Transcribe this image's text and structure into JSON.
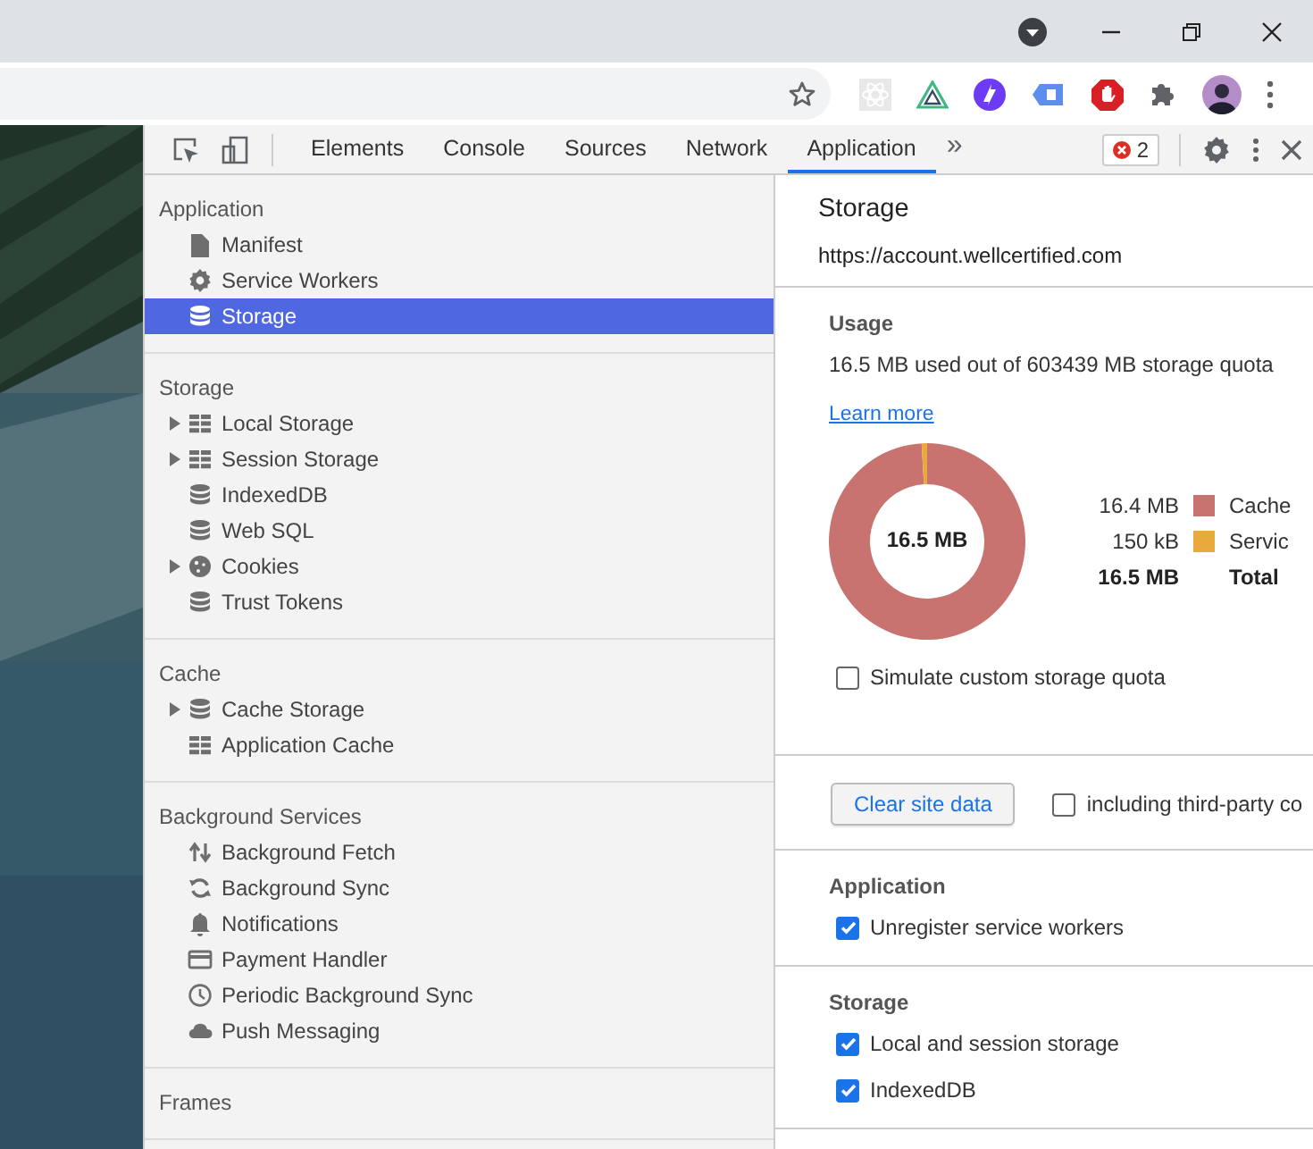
{
  "devtools": {
    "tabs": [
      {
        "label": "Elements",
        "selected": false
      },
      {
        "label": "Console",
        "selected": false
      },
      {
        "label": "Sources",
        "selected": false
      },
      {
        "label": "Network",
        "selected": false
      },
      {
        "label": "Application",
        "selected": true
      }
    ],
    "more_tabs": "»",
    "error_count": "2"
  },
  "sidebar": {
    "sections": [
      {
        "title": "Application",
        "items": [
          {
            "label": "Manifest",
            "kind": "manifest",
            "expandable": false,
            "selected": false
          },
          {
            "label": "Service Workers",
            "kind": "gear",
            "expandable": false,
            "selected": false
          },
          {
            "label": "Storage",
            "kind": "database",
            "expandable": false,
            "selected": true
          }
        ]
      },
      {
        "title": "Storage",
        "items": [
          {
            "label": "Local Storage",
            "kind": "table",
            "expandable": true,
            "expanded": false,
            "selected": false
          },
          {
            "label": "Session Storage",
            "kind": "table",
            "expandable": true,
            "expanded": false,
            "selected": false
          },
          {
            "label": "IndexedDB",
            "kind": "database",
            "expandable": false,
            "selected": false
          },
          {
            "label": "Web SQL",
            "kind": "database",
            "expandable": false,
            "selected": false
          },
          {
            "label": "Cookies",
            "kind": "cookie",
            "expandable": true,
            "expanded": false,
            "selected": false
          },
          {
            "label": "Trust Tokens",
            "kind": "database",
            "expandable": false,
            "selected": false
          }
        ]
      },
      {
        "title": "Cache",
        "items": [
          {
            "label": "Cache Storage",
            "kind": "database",
            "expandable": true,
            "expanded": false,
            "selected": false
          },
          {
            "label": "Application Cache",
            "kind": "table",
            "expandable": false,
            "selected": false
          }
        ]
      },
      {
        "title": "Background Services",
        "items": [
          {
            "label": "Background Fetch",
            "kind": "fetch",
            "expandable": false,
            "selected": false
          },
          {
            "label": "Background Sync",
            "kind": "sync",
            "expandable": false,
            "selected": false
          },
          {
            "label": "Notifications",
            "kind": "bell",
            "expandable": false,
            "selected": false
          },
          {
            "label": "Payment Handler",
            "kind": "card",
            "expandable": false,
            "selected": false
          },
          {
            "label": "Periodic Background Sync",
            "kind": "clock",
            "expandable": false,
            "selected": false
          },
          {
            "label": "Push Messaging",
            "kind": "cloud",
            "expandable": false,
            "selected": false
          }
        ]
      },
      {
        "title": "Frames"
      }
    ]
  },
  "panel": {
    "title": "Storage",
    "origin": "https://account.wellcertified.com",
    "usage": {
      "heading": "Usage",
      "summary": "16.5 MB used out of 603439 MB storage quota",
      "link": "Learn more",
      "center_label": "16.5 MB",
      "chart_data": {
        "type": "donut",
        "categories": [
          "Cache",
          "Servic"
        ],
        "values": [
          99.1,
          0.9
        ]
      },
      "legend": [
        {
          "value": "16.4 MB",
          "color": "#c97371"
        },
        {
          "value": "150 kB",
          "color": "#e8aa3c"
        }
      ],
      "total": {
        "value": "16.5 MB",
        "label": "Total"
      },
      "simulate": {
        "label": "Simulate custom storage quota",
        "checked": false
      }
    },
    "clear_button": "Clear site data",
    "third_party": {
      "label": "including third-party co",
      "checked": false
    },
    "sections": [
      {
        "title": "Application",
        "options": [
          {
            "label": "Unregister service workers",
            "checked": true
          }
        ]
      },
      {
        "title": "Storage",
        "options": [
          {
            "label": "Local and session storage",
            "checked": true
          },
          {
            "label": "IndexedDB",
            "checked": true
          }
        ]
      }
    ]
  }
}
